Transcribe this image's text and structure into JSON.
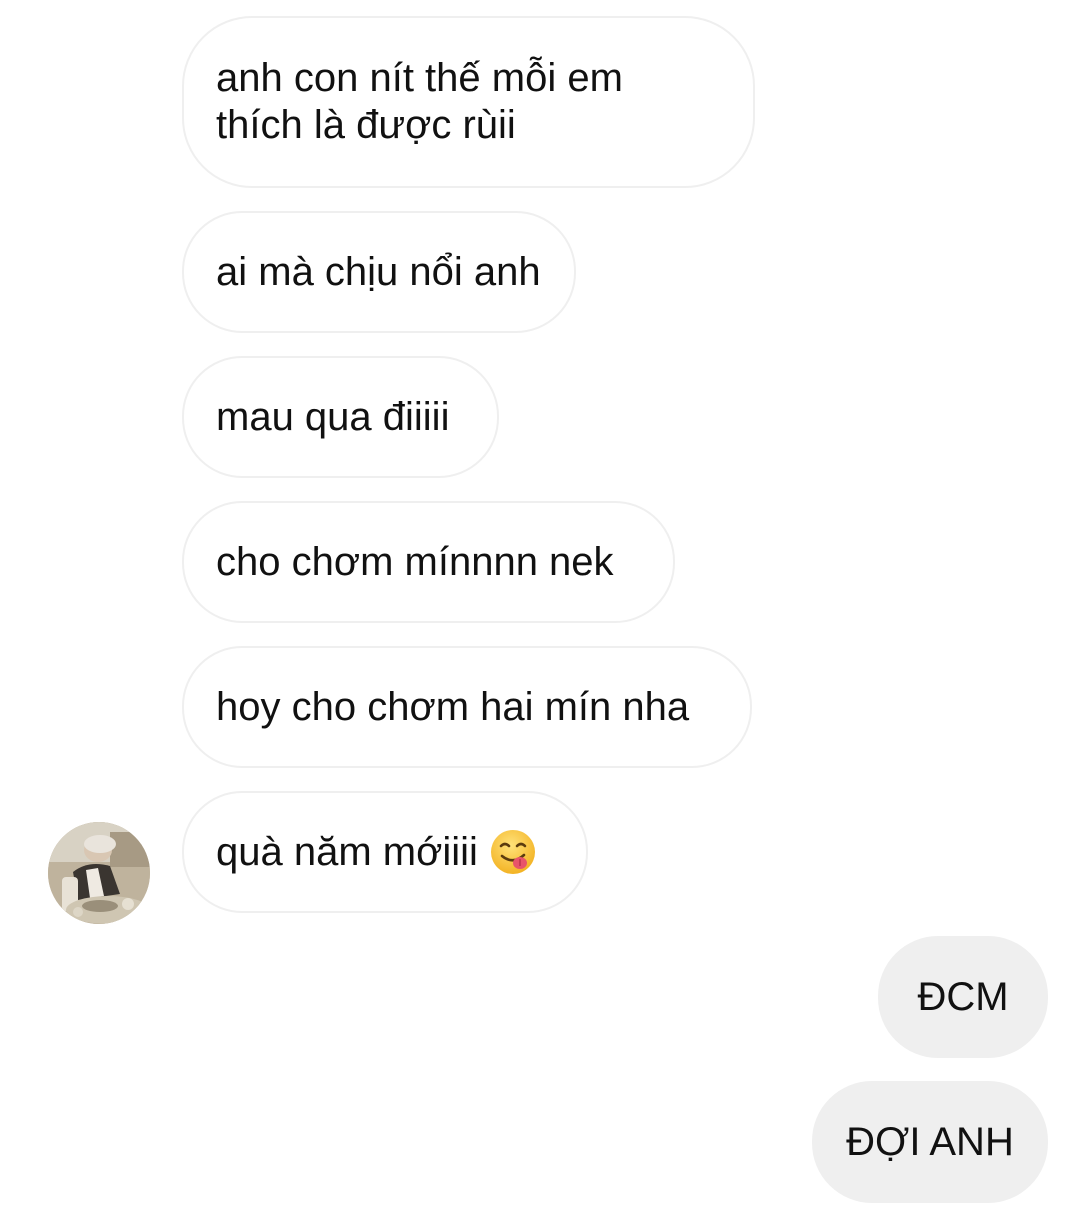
{
  "conversation": {
    "incoming": [
      {
        "text": "anh con nít thế mỗi em thích là được rùii"
      },
      {
        "text": "ai mà chịu nổi anh"
      },
      {
        "text": "mau qua điiiii"
      },
      {
        "text": "cho chơm mínnnn nek"
      },
      {
        "text": "hoy cho chơm hai mín nha"
      },
      {
        "text": "quà năm mớiiii",
        "emoji": "face-savoring-food-icon"
      }
    ],
    "outgoing": [
      {
        "text": "ĐCM"
      },
      {
        "text": "ĐỢI ANH"
      }
    ],
    "sender_avatar": "contact-avatar-photo"
  },
  "colors": {
    "background": "#ffffff",
    "incoming_border": "#efefef",
    "outgoing_fill": "#efefef",
    "text": "#111111",
    "emoji_face": "#f8c23a",
    "emoji_tongue": "#e8546a"
  }
}
